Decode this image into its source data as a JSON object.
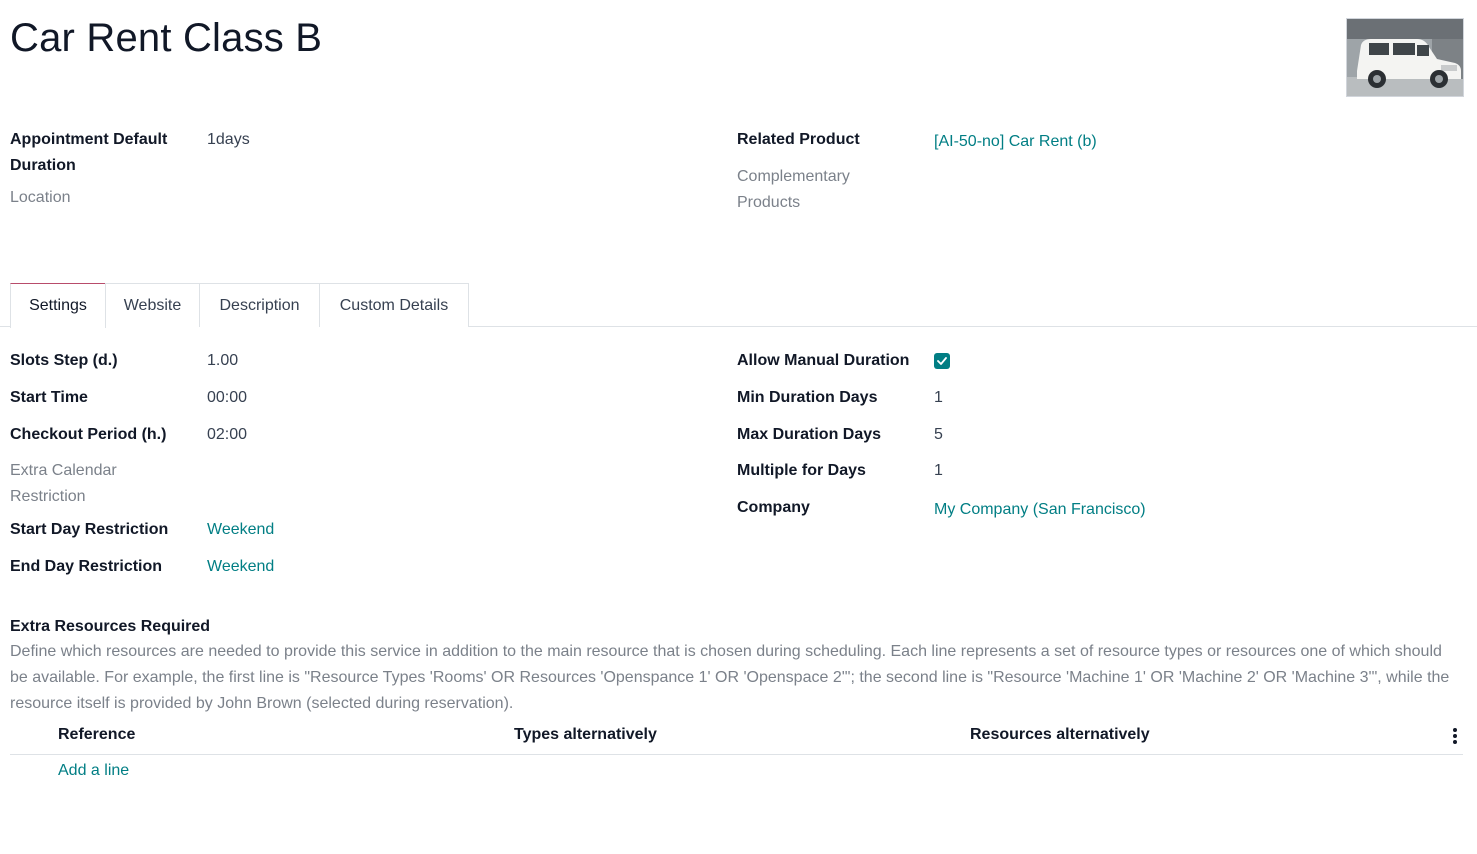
{
  "record": {
    "title": "Car Rent Class B",
    "image_alt": "white SUV in parking garage"
  },
  "header_fields": {
    "duration_label_line1": "Appointment Default",
    "duration_label_line2": "Duration",
    "duration_value": "1days",
    "location_label": "Location",
    "related_product_label": "Related Product",
    "related_product_value": "[AI-50-no] Car Rent (b)",
    "complementary_label_line1": "Complementary",
    "complementary_label_line2": "Products"
  },
  "tabs": [
    {
      "label": "Settings",
      "active": true
    },
    {
      "label": "Website",
      "active": false
    },
    {
      "label": "Description",
      "active": false
    },
    {
      "label": "Custom Details",
      "active": false
    }
  ],
  "settings": {
    "slots_step_label": "Slots Step (d.)",
    "slots_step_value": "1.00",
    "start_time_label": "Start Time",
    "start_time_value": "00:00",
    "checkout_label": "Checkout Period (h.)",
    "checkout_value": "02:00",
    "extra_calendar_line1": "Extra Calendar",
    "extra_calendar_line2": "Restriction",
    "start_day_label": "Start Day Restriction",
    "start_day_value": "Weekend",
    "end_day_label": "End Day Restriction",
    "end_day_value": "Weekend",
    "allow_manual_label": "Allow Manual Duration",
    "allow_manual_checked": true,
    "min_days_label": "Min Duration Days",
    "min_days_value": "1",
    "max_days_label": "Max Duration Days",
    "max_days_value": "5",
    "multiple_label": "Multiple for Days",
    "multiple_value": "1",
    "company_label": "Company",
    "company_value": "My Company (San Francisco)"
  },
  "extra_resources": {
    "title": "Extra Resources Required",
    "help": "Define which resources are needed to provide this service in addition to the main resource that is chosen during scheduling. Each line represents a set of resource types or resources one of which should be available. For example, the first line is \"Resource Types 'Rooms' OR Resources 'Openspance 1' OR 'Openspace 2'\"; the second line is \"Resource 'Machine 1' OR 'Machine 2' OR 'Machine 3'\", while the resource itself is provided by John Brown (selected during reservation).",
    "columns": [
      "Reference",
      "Types alternatively",
      "Resources alternatively"
    ],
    "add_line": "Add a line"
  },
  "colors": {
    "accent": "#017e84",
    "active_tab_top": "#b84c6b",
    "muted_text": "#7b818a"
  }
}
